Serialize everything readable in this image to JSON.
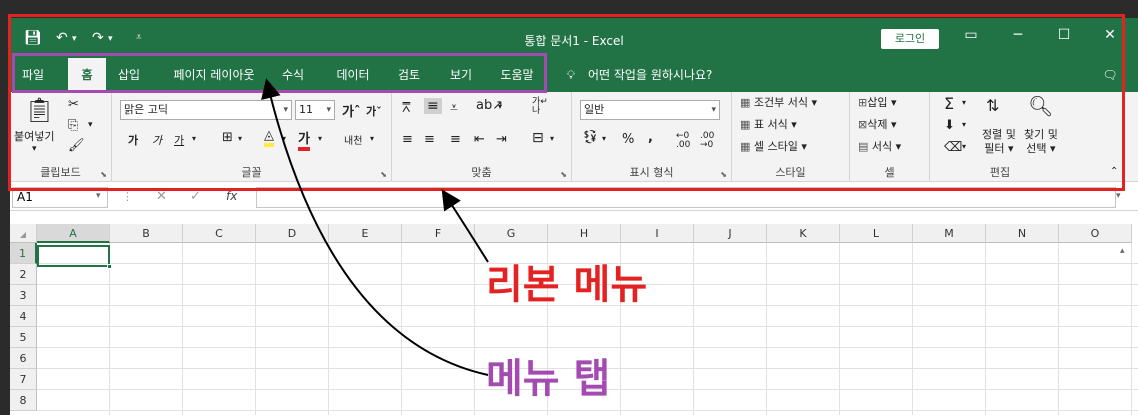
{
  "window": {
    "title": "통합 문서1  -  Excel",
    "login_label": "로그인"
  },
  "tabs": [
    "파일",
    "홈",
    "삽입",
    "페이지 레이아웃",
    "수식",
    "데이터",
    "검토",
    "보기",
    "도움말"
  ],
  "tabs_extra": {
    "tell_me": "어떤 작업을 원하시나요?"
  },
  "ribbon": {
    "clipboard": {
      "paste": "붙여넣기",
      "label": "클립보드"
    },
    "font": {
      "font_name": "맑은 고딕",
      "font_size": "11",
      "label": "글꼴"
    },
    "alignment": {
      "label": "맞춤"
    },
    "number": {
      "format": "일반",
      "label": "표시 형식"
    },
    "styles": {
      "conditional": "조건부 서식",
      "table": "표 서식",
      "cell": "셀 스타일",
      "label": "스타일"
    },
    "cells": {
      "insert": "삽입",
      "delete": "삭제",
      "format": "서식",
      "label": "셀"
    },
    "editing": {
      "sort_filter_1": "정렬 및",
      "sort_filter_2": "필터",
      "find_select_1": "찾기 및",
      "find_select_2": "선택",
      "label": "편집"
    }
  },
  "formula_bar": {
    "name_box": "A1"
  },
  "columns": [
    "A",
    "B",
    "C",
    "D",
    "E",
    "F",
    "G",
    "H",
    "I",
    "J",
    "K",
    "L",
    "M",
    "N",
    "O"
  ],
  "rows": [
    "1",
    "2",
    "3",
    "4",
    "5",
    "6",
    "7",
    "8"
  ],
  "annotations": {
    "ribbon": "리본 메뉴",
    "tabs": "메뉴 탭"
  },
  "colors": {
    "excel_green": "#217346",
    "ribbon_box": "#e52222",
    "tabs_box": "#a34bb0"
  }
}
